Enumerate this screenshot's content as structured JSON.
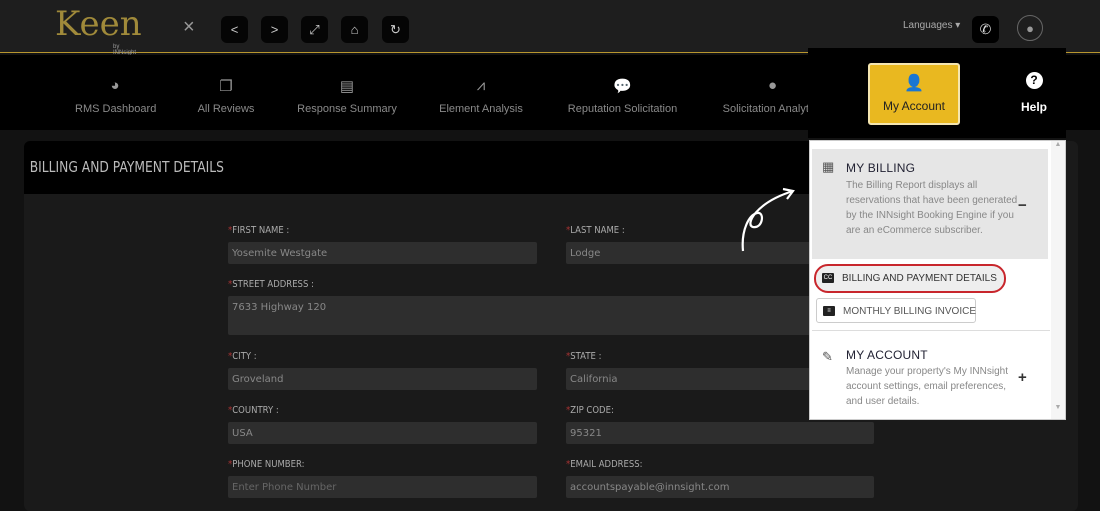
{
  "topbar": {
    "logo": "Keen",
    "logo_sub": "by INNsight",
    "close": "×",
    "languages": "Languages ▾"
  },
  "nav": [
    {
      "label": "RMS Dashboard",
      "icon": "dashboard-icon",
      "glyph": "◕"
    },
    {
      "label": "All Reviews",
      "icon": "reviews-icon",
      "glyph": "❐"
    },
    {
      "label": "Response Summary",
      "icon": "document-icon",
      "glyph": "▤"
    },
    {
      "label": "Element Analysis",
      "icon": "chart-icon",
      "glyph": "⩘"
    },
    {
      "label": "Reputation Solicitation",
      "icon": "chat-icon",
      "glyph": "💬"
    },
    {
      "label": "Solicitation Analytics",
      "icon": "comment-icon",
      "glyph": "●"
    }
  ],
  "my_account": "My Account",
  "help": "Help",
  "page": {
    "title": "BILLING AND PAYMENT DETAILS",
    "fields": {
      "first_name": {
        "label": "FIRST NAME :",
        "value": "Yosemite Westgate"
      },
      "last_name": {
        "label": "LAST NAME :",
        "value": "Lodge"
      },
      "street": {
        "label": "STREET ADDRESS :",
        "value": "7633 Highway 120"
      },
      "city": {
        "label": "CITY :",
        "value": "Groveland"
      },
      "state": {
        "label": "STATE :",
        "value": "California"
      },
      "country": {
        "label": "COUNTRY :",
        "value": "USA"
      },
      "zip": {
        "label": "ZIP CODE:",
        "value": "95321"
      },
      "phone": {
        "label": "PHONE NUMBER:",
        "placeholder": "Enter Phone Number"
      },
      "email": {
        "label": "EMAIL ADDRESS:",
        "value": "accountspayable@innsight.com"
      }
    }
  },
  "dropdown": {
    "billing": {
      "title": "MY BILLING",
      "desc": "The Billing Report displays all reservations that have been generated by the INNsight Booking Engine if you are an eCommerce subscriber.",
      "toggle": "−"
    },
    "billing_payment": "BILLING AND PAYMENT DETAILS",
    "cc_icon": "CC",
    "monthly_invoice": "MONTHLY BILLING INVOICE",
    "account": {
      "title": "MY ACCOUNT",
      "desc": "Manage your property's My INNsight account settings, email preferences, and user details.",
      "toggle": "+"
    }
  },
  "colors": {
    "accent": "#e9b820",
    "highlight": "#c8262c",
    "gold_line": "#b8962e"
  }
}
